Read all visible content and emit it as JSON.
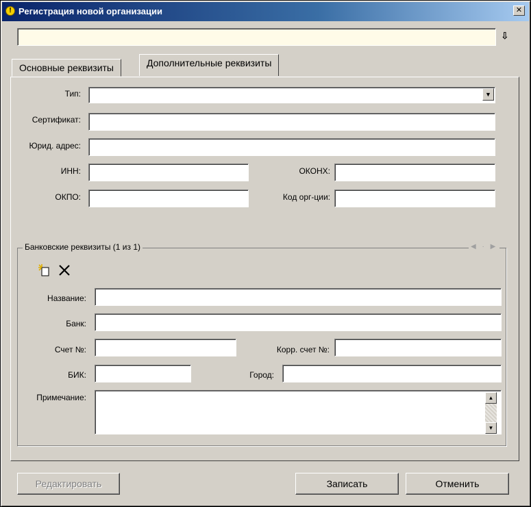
{
  "window": {
    "title": "Регистрация новой организации",
    "close_glyph": "✕"
  },
  "top_field": {
    "value": ""
  },
  "pin_glyph": "⇩",
  "tabs": [
    {
      "label": "Основные реквизиты",
      "active": false
    },
    {
      "label": "Дополнительные реквизиты",
      "active": true
    }
  ],
  "form": {
    "type_label": "Тип:",
    "type_value": "",
    "cert_label": "Сертификат:",
    "cert_value": "",
    "address_label": "Юрид. адрес:",
    "address_value": "",
    "inn_label": "ИНН:",
    "inn_value": "",
    "okonh_label": "ОКОНХ:",
    "okonh_value": "",
    "okpo_label": "ОКПО:",
    "okpo_value": "",
    "orgcode_label": "Код орг-ции:",
    "orgcode_value": ""
  },
  "bank": {
    "legend": "Банковские реквизиты (1 из 1)",
    "nav": "◀ · ▶",
    "name_label": "Название:",
    "name_value": "",
    "bank_label": "Банк:",
    "bank_value": "",
    "account_label": "Счет №:",
    "account_value": "",
    "corr_label": "Корр. счет №:",
    "corr_value": "",
    "bik_label": "БИК:",
    "bik_value": "",
    "city_label": "Город:",
    "city_value": "",
    "note_label": "Примечание:",
    "note_value": ""
  },
  "buttons": {
    "edit": "Редактировать",
    "save": "Записать",
    "cancel": "Отменить"
  },
  "icons": {
    "new_record": "new-record-icon",
    "delete": "delete-icon",
    "combo_arrow": "▼",
    "scroll_up": "▲",
    "scroll_down": "▼"
  },
  "colors": {
    "window_bg": "#d4d0c8",
    "title_start": "#0a246a",
    "title_end": "#a6caf0",
    "top_field_bg": "#fffbe8"
  }
}
